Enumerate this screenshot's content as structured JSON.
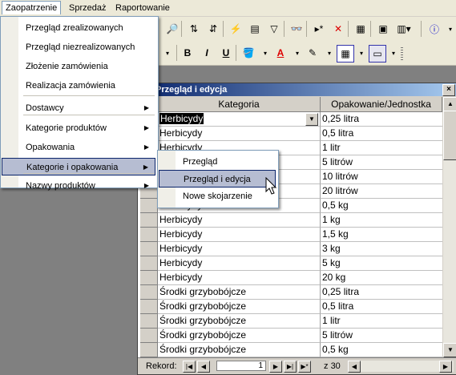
{
  "menubar": {
    "items": [
      "Zaopatrzenie",
      "Sprzedaż",
      "Raportowanie"
    ]
  },
  "dropdown": {
    "items": [
      {
        "label": "Przegląd zrealizowanych",
        "submenu": false
      },
      {
        "label": "Przegląd niezrealizowanych",
        "submenu": false
      },
      {
        "label": "Złożenie zamówienia",
        "submenu": false
      },
      {
        "label": "Realizacja zamówienia",
        "submenu": false
      },
      {
        "label": "Dostawcy",
        "submenu": true
      },
      {
        "label": "Kategorie produktów",
        "submenu": true
      },
      {
        "label": "Opakowania",
        "submenu": true
      },
      {
        "label": "Kategorie i opakowania",
        "submenu": true
      },
      {
        "label": "Nazwy produktów",
        "submenu": true
      }
    ],
    "submenu_items": [
      "Przegląd",
      "Przegląd i edycja",
      "Nowe skojarzenie"
    ]
  },
  "toolbar": {
    "bold": "B",
    "italic": "I",
    "underline": "U",
    "font_color_letter": "A"
  },
  "form": {
    "title": "Przegląd i edycja",
    "close": "×",
    "columns": [
      "Kategoria",
      "Opakowanie/Jednostka"
    ],
    "rows": [
      [
        "Herbicydy",
        "0,25 litra"
      ],
      [
        "Herbicydy",
        "0,5 litra"
      ],
      [
        "Herbicydy",
        "1 litr"
      ],
      [
        "Herbicydy",
        "5 litrów"
      ],
      [
        "Herbicydy",
        "10 litrów"
      ],
      [
        "Herbicydy",
        "20 litrów"
      ],
      [
        "Herbicydy",
        "0,5 kg"
      ],
      [
        "Herbicydy",
        "1 kg"
      ],
      [
        "Herbicydy",
        "1,5 kg"
      ],
      [
        "Herbicydy",
        "3 kg"
      ],
      [
        "Herbicydy",
        "5 kg"
      ],
      [
        "Herbicydy",
        "20 kg"
      ],
      [
        "Środki grzybobójcze",
        "0,25 litra"
      ],
      [
        "Środki grzybobójcze",
        "0,5 litra"
      ],
      [
        "Środki grzybobójcze",
        "1 litr"
      ],
      [
        "Środki grzybobójcze",
        "5 litrów"
      ],
      [
        "Środki grzybobójcze",
        "0,5 kg"
      ]
    ],
    "record_label": "Rekord:",
    "record_current": "1",
    "record_total_prefix": "z",
    "record_total": "30"
  }
}
